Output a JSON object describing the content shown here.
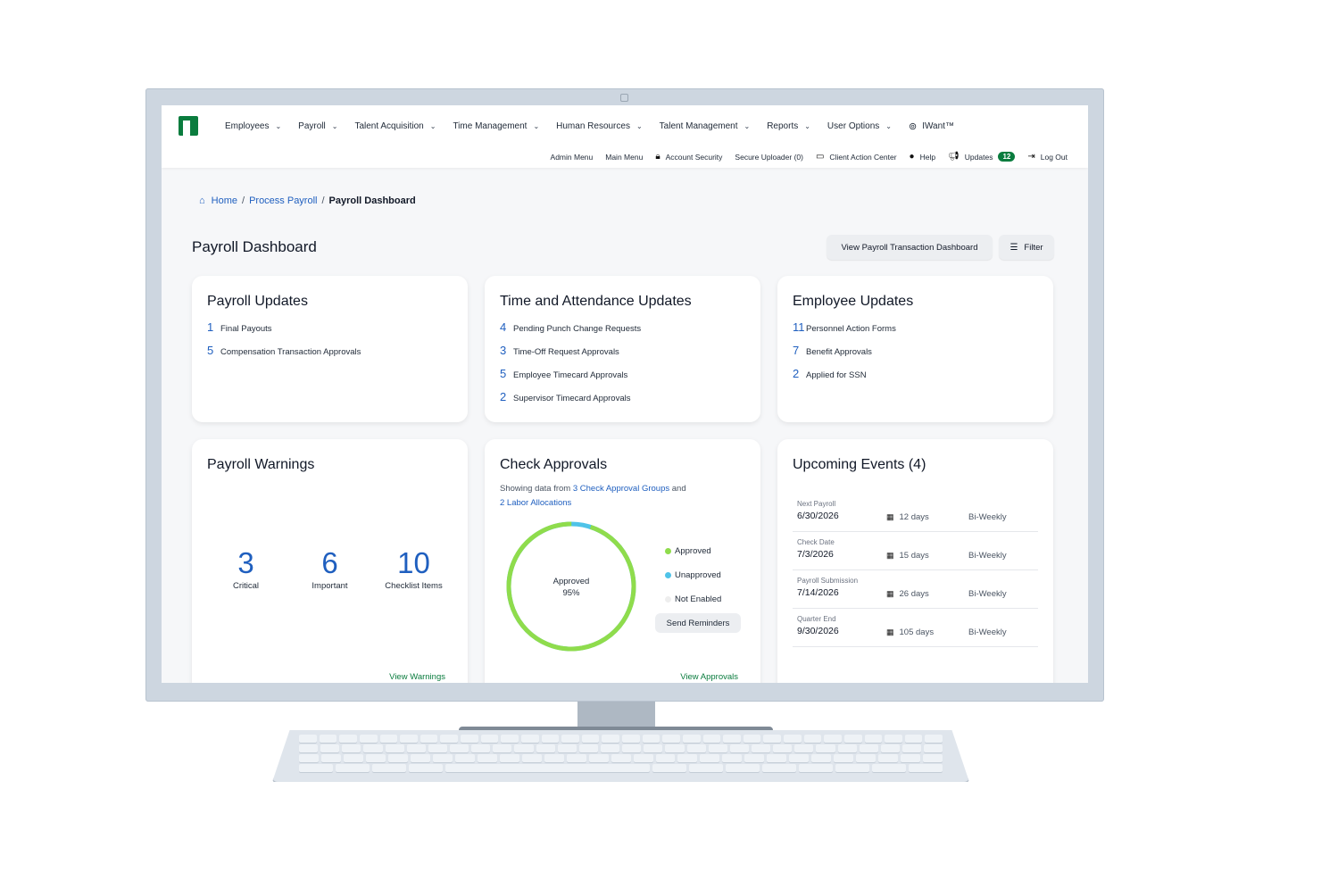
{
  "nav": {
    "main": [
      {
        "label": "Employees"
      },
      {
        "label": "Payroll"
      },
      {
        "label": "Talent Acquisition"
      },
      {
        "label": "Time Management"
      },
      {
        "label": "Human Resources"
      },
      {
        "label": "Talent Management"
      },
      {
        "label": "Reports"
      },
      {
        "label": "User Options"
      }
    ],
    "iwant": "IWant™",
    "sub": {
      "admin_menu": "Admin Menu",
      "main_menu": "Main Menu",
      "account_security": "Account Security",
      "secure_uploader": "Secure Uploader (0)",
      "client_action_center": "Client Action Center",
      "help": "Help",
      "updates": "Updates",
      "updates_count": "12",
      "log_out": "Log Out"
    }
  },
  "breadcrumb": {
    "home": "Home",
    "process_payroll": "Process Payroll",
    "current": "Payroll Dashboard"
  },
  "page": {
    "title": "Payroll Dashboard",
    "view_transaction_btn": "View Payroll Transaction Dashboard",
    "filter_btn": "Filter"
  },
  "payroll_updates": {
    "title": "Payroll Updates",
    "items": [
      {
        "count": "1",
        "label": "Final Payouts"
      },
      {
        "count": "5",
        "label": "Compensation Transaction Approvals"
      }
    ]
  },
  "time_updates": {
    "title": "Time and Attendance Updates",
    "items": [
      {
        "count": "4",
        "label": "Pending Punch Change Requests"
      },
      {
        "count": "3",
        "label": "Time-Off Request Approvals"
      },
      {
        "count": "5",
        "label": "Employee Timecard Approvals"
      },
      {
        "count": "2",
        "label": "Supervisor Timecard Approvals"
      }
    ]
  },
  "employee_updates": {
    "title": "Employee Updates",
    "items": [
      {
        "count": "11",
        "label": "Personnel Action Forms"
      },
      {
        "count": "7",
        "label": "Benefit Approvals"
      },
      {
        "count": "2",
        "label": "Applied for SSN"
      }
    ]
  },
  "payroll_warnings": {
    "title": "Payroll Warnings",
    "stats": [
      {
        "value": "3",
        "label": "Critical"
      },
      {
        "value": "6",
        "label": "Important"
      },
      {
        "value": "10",
        "label": "Checklist Items"
      }
    ],
    "link": "View Warnings"
  },
  "check_approvals": {
    "title": "Check Approvals",
    "showing_prefix": "Showing data from",
    "groups_link": "3 Check Approval Groups",
    "and": "and",
    "labor_link": "2 Labor Allocations",
    "donut_label": "Approved",
    "donut_value": "95%",
    "approved_fraction": 0.95,
    "legend": [
      {
        "label": "Approved",
        "color": "#8fdc4c"
      },
      {
        "label": "Unapproved",
        "color": "#4fc3e8"
      },
      {
        "label": "Not Enabled",
        "color": "#eeeeee"
      }
    ],
    "send_btn": "Send Reminders",
    "link": "View Approvals"
  },
  "upcoming_events": {
    "title": "Upcoming Events (4)",
    "events": [
      {
        "label": "Next Payroll",
        "date": "6/30/2026",
        "days": "12 days",
        "freq": "Bi-Weekly"
      },
      {
        "label": "Check Date",
        "date": "7/3/2026",
        "days": "15 days",
        "freq": "Bi-Weekly"
      },
      {
        "label": "Payroll Submission",
        "date": "7/14/2026",
        "days": "26 days",
        "freq": "Bi-Weekly"
      },
      {
        "label": "Quarter End",
        "date": "9/30/2026",
        "days": "105 days",
        "freq": "Bi-Weekly"
      }
    ]
  },
  "colors": {
    "brand": "#0a7c3e",
    "link": "#1f5fbf",
    "approved": "#8fdc4c",
    "unapproved": "#4fc3e8"
  }
}
